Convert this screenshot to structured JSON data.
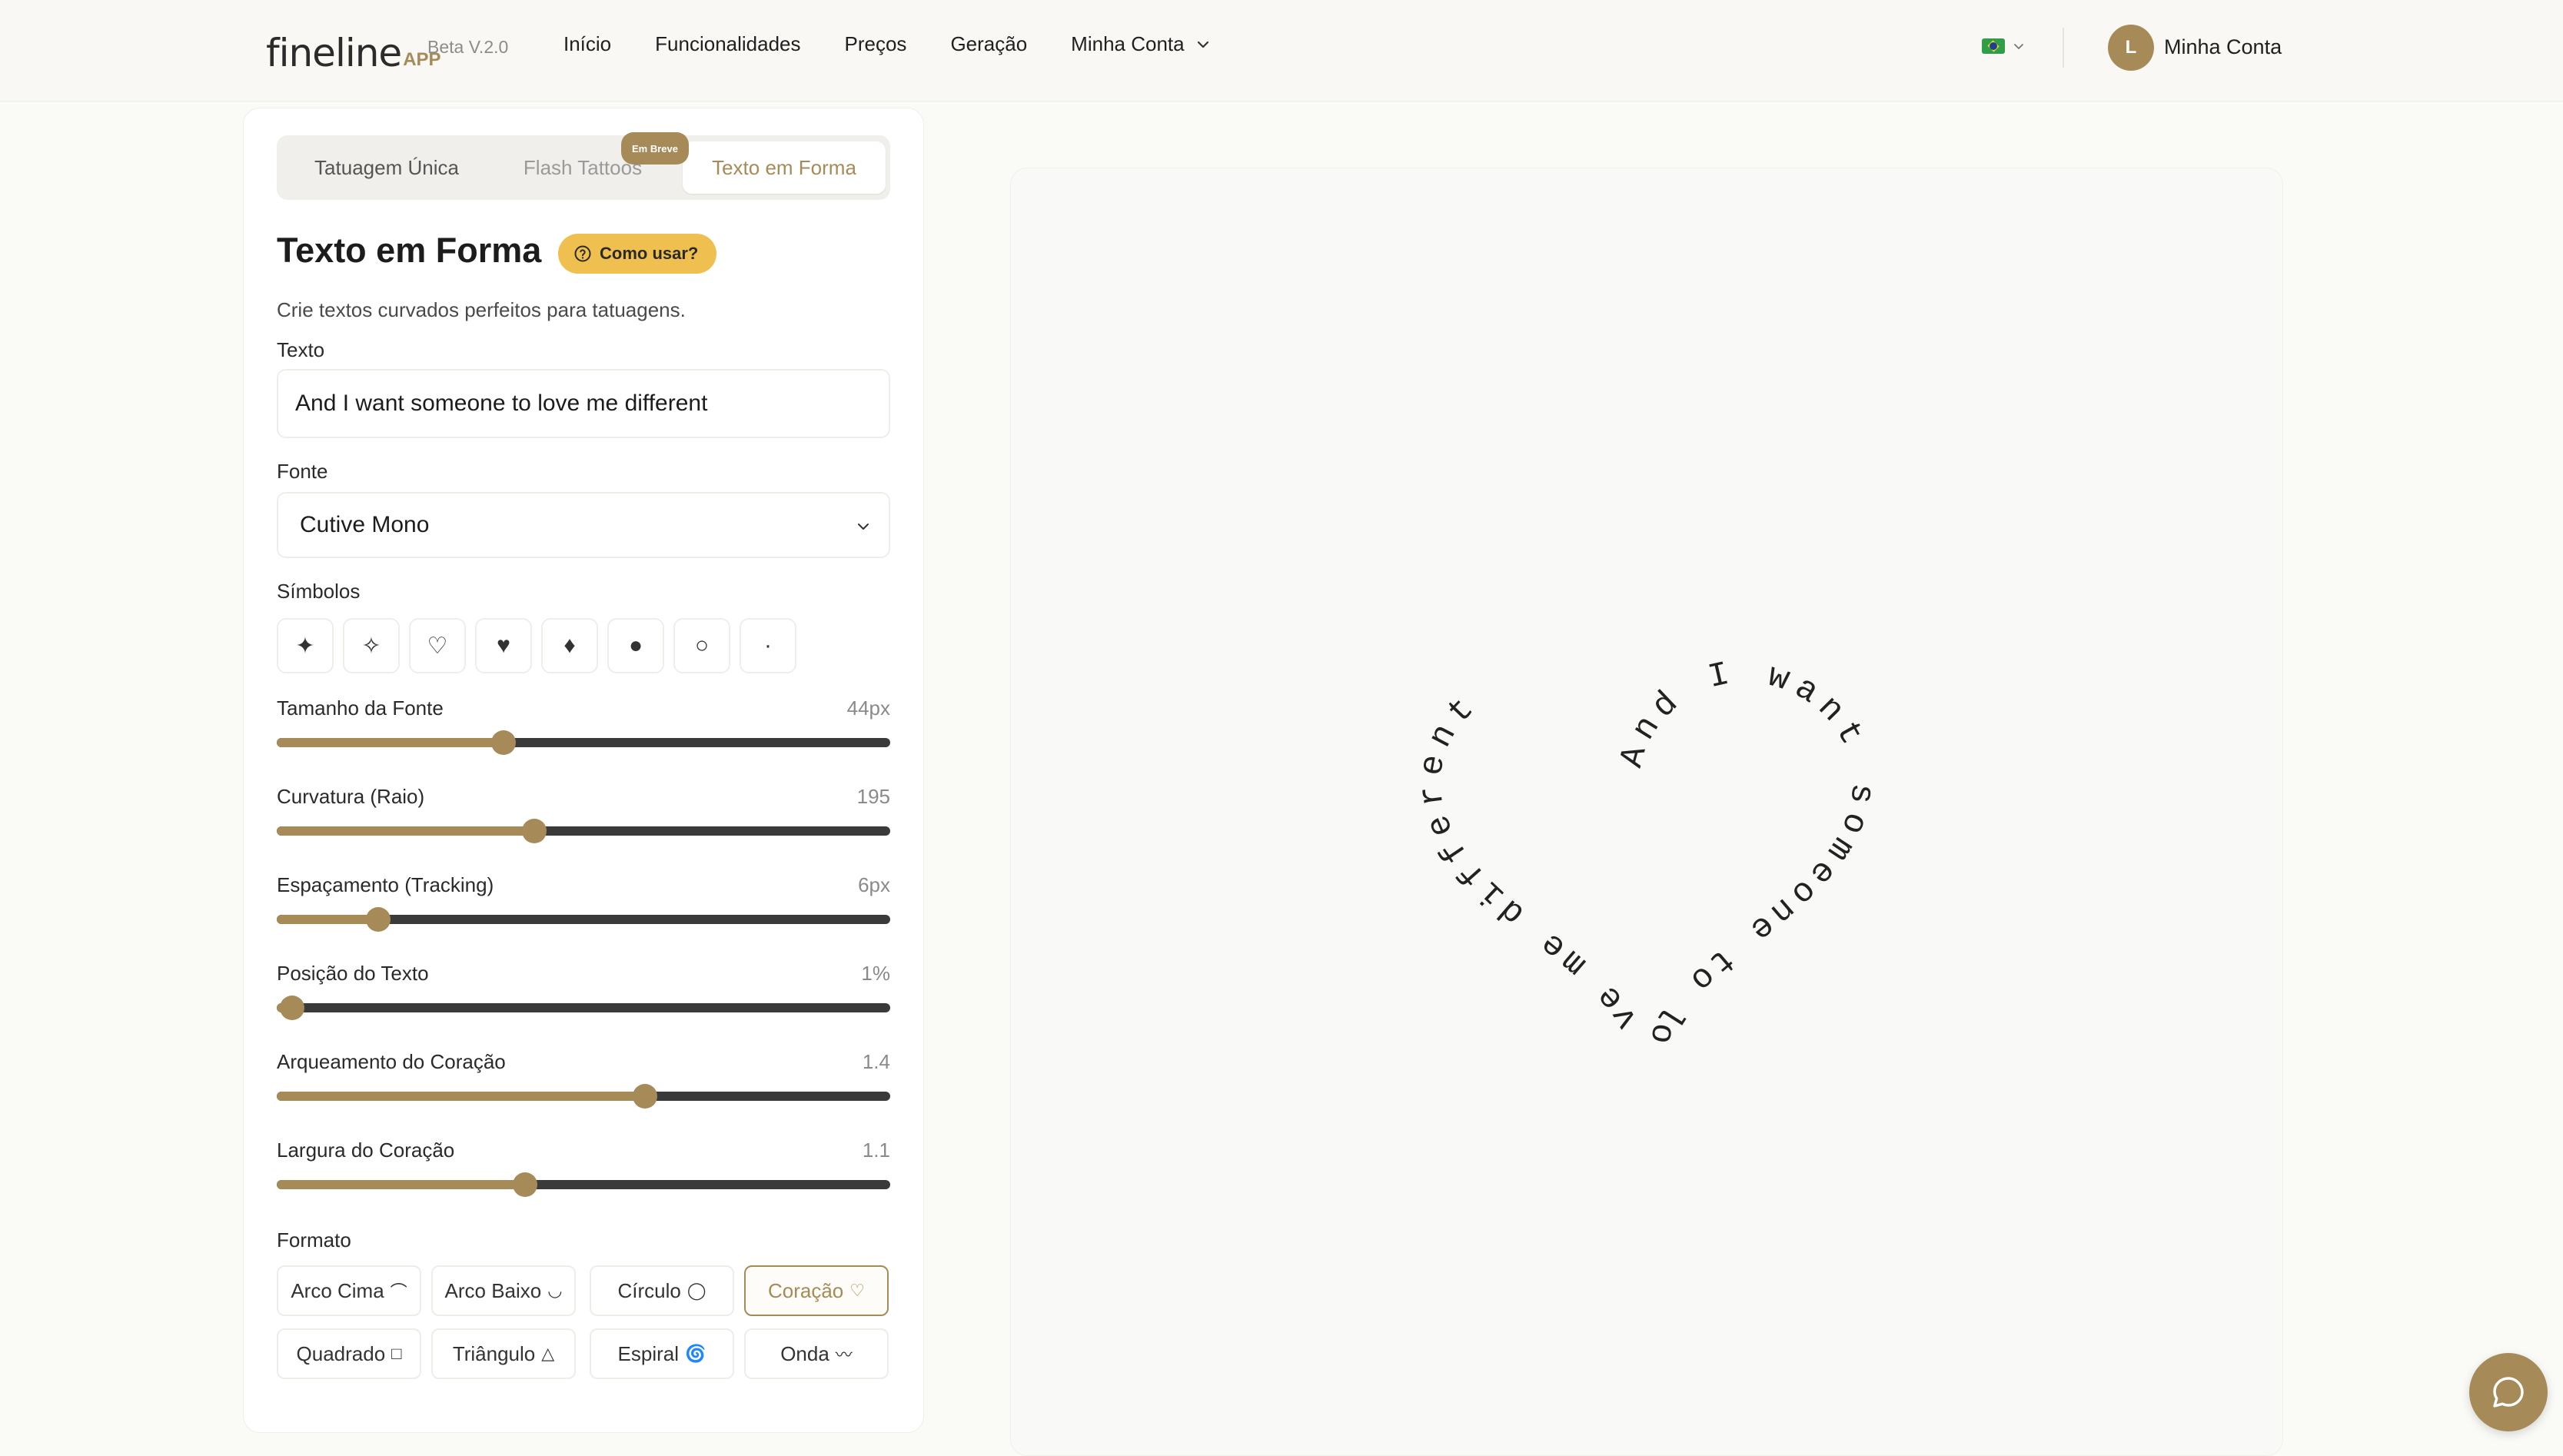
{
  "header": {
    "logo_word": "fineline",
    "logo_app": "APP",
    "version": "Beta V.2.0",
    "nav": [
      "Início",
      "Funcionalidades",
      "Preços",
      "Geração",
      "Minha Conta"
    ],
    "avatar_initial": "L",
    "account_label": "Minha Conta",
    "language_flag_icon": "brazil-flag-icon"
  },
  "tabs": {
    "items": [
      "Tatuagem Única",
      "Flash Tattoos",
      "Texto em Forma"
    ],
    "active": "Texto em Forma",
    "soon_badge": "Em Breve"
  },
  "editor": {
    "title": "Texto em Forma",
    "howto_label": "Como usar?",
    "subtitle": "Crie textos curvados perfeitos para tatuagens.",
    "text_label": "Texto",
    "text_value": "And I want someone to love me different",
    "font_label": "Fonte",
    "font_value": "Cutive Mono",
    "symbols_label": "Símbolos",
    "symbols": [
      "✦",
      "✧",
      "♡",
      "♥",
      "♦",
      "●",
      "○",
      "·"
    ],
    "sliders": [
      {
        "label": "Tamanho da Fonte",
        "value": "44px",
        "fraction": 0.37
      },
      {
        "label": "Curvatura (Raio)",
        "value": "195",
        "fraction": 0.42
      },
      {
        "label": "Espaçamento (Tracking)",
        "value": "6px",
        "fraction": 0.165
      },
      {
        "label": "Posição do Texto",
        "value": "1%",
        "fraction": 0.025
      },
      {
        "label": "Arqueamento do Coração",
        "value": "1.4",
        "fraction": 0.6
      },
      {
        "label": "Largura do Coração",
        "value": "1.1",
        "fraction": 0.405
      }
    ],
    "format_label": "Formato",
    "formats": [
      {
        "label": "Arco Cima",
        "glyph": "⌒"
      },
      {
        "label": "Arco Baixo",
        "glyph": "◡"
      },
      {
        "label": "Círculo",
        "glyph": "◯"
      },
      {
        "label": "Coração",
        "glyph": "♡"
      },
      {
        "label": "Quadrado",
        "glyph": "□"
      },
      {
        "label": "Triângulo",
        "glyph": "△"
      },
      {
        "label": "Espiral",
        "glyph": "🌀"
      },
      {
        "label": "Onda",
        "glyph": "〰"
      }
    ],
    "active_format": "Coração"
  },
  "preview": {
    "text": "And I want someone to love me different"
  },
  "colors": {
    "accent": "#a68b58",
    "howto_bg": "#efc04f",
    "track_dark": "#3a3a3a"
  }
}
